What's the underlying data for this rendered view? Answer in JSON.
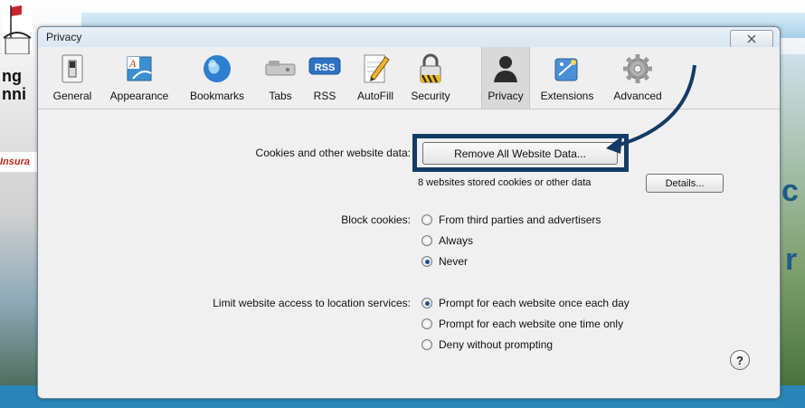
{
  "window": {
    "title": "Privacy"
  },
  "toolbar": {
    "items": [
      {
        "label": "General",
        "icon": "switch-icon"
      },
      {
        "label": "Appearance",
        "icon": "font-icon"
      },
      {
        "label": "Bookmarks",
        "icon": "globe-icon"
      },
      {
        "label": "Tabs",
        "icon": "tabs-icon"
      },
      {
        "label": "RSS",
        "icon": "rss-icon",
        "badge": "RSS"
      },
      {
        "label": "AutoFill",
        "icon": "pencil-icon"
      },
      {
        "label": "Security",
        "icon": "lock-icon"
      },
      {
        "label": "Privacy",
        "icon": "person-icon"
      },
      {
        "label": "Extensions",
        "icon": "puzzle-icon"
      },
      {
        "label": "Advanced",
        "icon": "gear-icon"
      }
    ],
    "selected": "Privacy"
  },
  "cookies": {
    "label": "Cookies and other website data:",
    "remove_button": "Remove All Website Data...",
    "status": "8 websites stored cookies or other data",
    "details_button": "Details..."
  },
  "block_cookies": {
    "label": "Block cookies:",
    "options": [
      "From third parties and advertisers",
      "Always",
      "Never"
    ],
    "selected": "Never"
  },
  "location": {
    "label": "Limit website access to location services:",
    "options": [
      "Prompt for each website once each day",
      "Prompt for each website one time only",
      "Deny without prompting"
    ],
    "selected": "Prompt for each website once each day"
  },
  "help": {
    "label": "?"
  },
  "background": {
    "left_text": "ng\nnni",
    "left_banner": "Insura",
    "right_text_1": "c",
    "right_text_2": "r"
  },
  "colors": {
    "highlight": "#123c66",
    "radio_selected": "#1e4f8a"
  }
}
